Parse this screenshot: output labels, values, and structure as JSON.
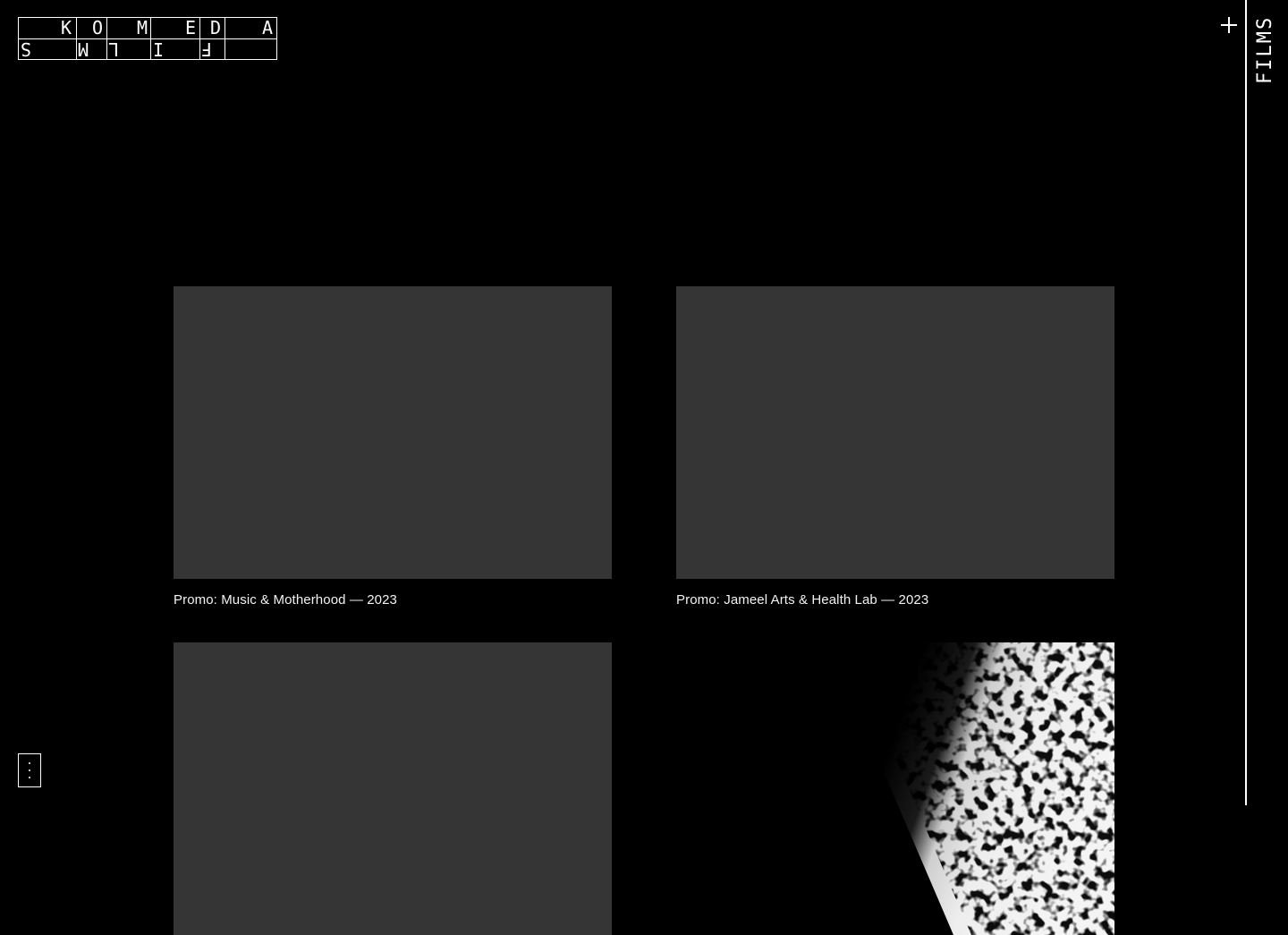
{
  "logo": {
    "top_letters": [
      "K",
      "O",
      "M",
      "E",
      "D",
      "A"
    ],
    "bottom_letters": [
      "S",
      "M",
      "L",
      "I",
      "F",
      ""
    ]
  },
  "rail": {
    "label": "FILMS"
  },
  "icons": {
    "add": "plus-icon",
    "menu": "vertical-dots-icon"
  },
  "films": [
    {
      "caption": "Promo: Music & Motherhood — 2023"
    },
    {
      "caption": "Promo: Jameel Arts & Health Lab — 2023"
    },
    {
      "caption": ""
    },
    {
      "caption": ""
    }
  ],
  "colors": {
    "background": "#000000",
    "placeholder": "#353535",
    "text": "#ffffff"
  }
}
